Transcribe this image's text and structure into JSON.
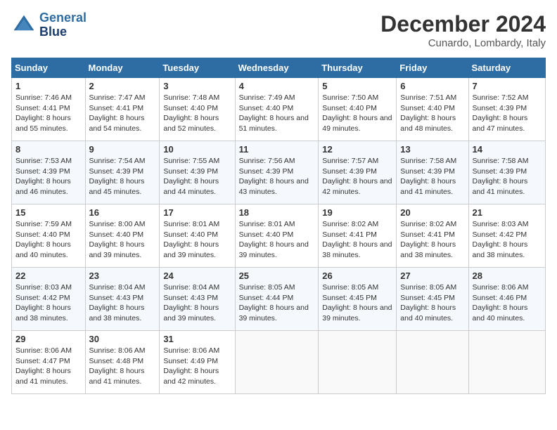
{
  "header": {
    "logo_line1": "General",
    "logo_line2": "Blue",
    "month_title": "December 2024",
    "location": "Cunardo, Lombardy, Italy"
  },
  "days_of_week": [
    "Sunday",
    "Monday",
    "Tuesday",
    "Wednesday",
    "Thursday",
    "Friday",
    "Saturday"
  ],
  "weeks": [
    [
      {
        "day": "1",
        "sunrise": "7:46 AM",
        "sunset": "4:41 PM",
        "daylight": "8 hours and 55 minutes."
      },
      {
        "day": "2",
        "sunrise": "7:47 AM",
        "sunset": "4:41 PM",
        "daylight": "8 hours and 54 minutes."
      },
      {
        "day": "3",
        "sunrise": "7:48 AM",
        "sunset": "4:40 PM",
        "daylight": "8 hours and 52 minutes."
      },
      {
        "day": "4",
        "sunrise": "7:49 AM",
        "sunset": "4:40 PM",
        "daylight": "8 hours and 51 minutes."
      },
      {
        "day": "5",
        "sunrise": "7:50 AM",
        "sunset": "4:40 PM",
        "daylight": "8 hours and 49 minutes."
      },
      {
        "day": "6",
        "sunrise": "7:51 AM",
        "sunset": "4:40 PM",
        "daylight": "8 hours and 48 minutes."
      },
      {
        "day": "7",
        "sunrise": "7:52 AM",
        "sunset": "4:39 PM",
        "daylight": "8 hours and 47 minutes."
      }
    ],
    [
      {
        "day": "8",
        "sunrise": "7:53 AM",
        "sunset": "4:39 PM",
        "daylight": "8 hours and 46 minutes."
      },
      {
        "day": "9",
        "sunrise": "7:54 AM",
        "sunset": "4:39 PM",
        "daylight": "8 hours and 45 minutes."
      },
      {
        "day": "10",
        "sunrise": "7:55 AM",
        "sunset": "4:39 PM",
        "daylight": "8 hours and 44 minutes."
      },
      {
        "day": "11",
        "sunrise": "7:56 AM",
        "sunset": "4:39 PM",
        "daylight": "8 hours and 43 minutes."
      },
      {
        "day": "12",
        "sunrise": "7:57 AM",
        "sunset": "4:39 PM",
        "daylight": "8 hours and 42 minutes."
      },
      {
        "day": "13",
        "sunrise": "7:58 AM",
        "sunset": "4:39 PM",
        "daylight": "8 hours and 41 minutes."
      },
      {
        "day": "14",
        "sunrise": "7:58 AM",
        "sunset": "4:39 PM",
        "daylight": "8 hours and 41 minutes."
      }
    ],
    [
      {
        "day": "15",
        "sunrise": "7:59 AM",
        "sunset": "4:40 PM",
        "daylight": "8 hours and 40 minutes."
      },
      {
        "day": "16",
        "sunrise": "8:00 AM",
        "sunset": "4:40 PM",
        "daylight": "8 hours and 39 minutes."
      },
      {
        "day": "17",
        "sunrise": "8:01 AM",
        "sunset": "4:40 PM",
        "daylight": "8 hours and 39 minutes."
      },
      {
        "day": "18",
        "sunrise": "8:01 AM",
        "sunset": "4:40 PM",
        "daylight": "8 hours and 39 minutes."
      },
      {
        "day": "19",
        "sunrise": "8:02 AM",
        "sunset": "4:41 PM",
        "daylight": "8 hours and 38 minutes."
      },
      {
        "day": "20",
        "sunrise": "8:02 AM",
        "sunset": "4:41 PM",
        "daylight": "8 hours and 38 minutes."
      },
      {
        "day": "21",
        "sunrise": "8:03 AM",
        "sunset": "4:42 PM",
        "daylight": "8 hours and 38 minutes."
      }
    ],
    [
      {
        "day": "22",
        "sunrise": "8:03 AM",
        "sunset": "4:42 PM",
        "daylight": "8 hours and 38 minutes."
      },
      {
        "day": "23",
        "sunrise": "8:04 AM",
        "sunset": "4:43 PM",
        "daylight": "8 hours and 38 minutes."
      },
      {
        "day": "24",
        "sunrise": "8:04 AM",
        "sunset": "4:43 PM",
        "daylight": "8 hours and 39 minutes."
      },
      {
        "day": "25",
        "sunrise": "8:05 AM",
        "sunset": "4:44 PM",
        "daylight": "8 hours and 39 minutes."
      },
      {
        "day": "26",
        "sunrise": "8:05 AM",
        "sunset": "4:45 PM",
        "daylight": "8 hours and 39 minutes."
      },
      {
        "day": "27",
        "sunrise": "8:05 AM",
        "sunset": "4:45 PM",
        "daylight": "8 hours and 40 minutes."
      },
      {
        "day": "28",
        "sunrise": "8:06 AM",
        "sunset": "4:46 PM",
        "daylight": "8 hours and 40 minutes."
      }
    ],
    [
      {
        "day": "29",
        "sunrise": "8:06 AM",
        "sunset": "4:47 PM",
        "daylight": "8 hours and 41 minutes."
      },
      {
        "day": "30",
        "sunrise": "8:06 AM",
        "sunset": "4:48 PM",
        "daylight": "8 hours and 41 minutes."
      },
      {
        "day": "31",
        "sunrise": "8:06 AM",
        "sunset": "4:49 PM",
        "daylight": "8 hours and 42 minutes."
      },
      null,
      null,
      null,
      null
    ]
  ]
}
